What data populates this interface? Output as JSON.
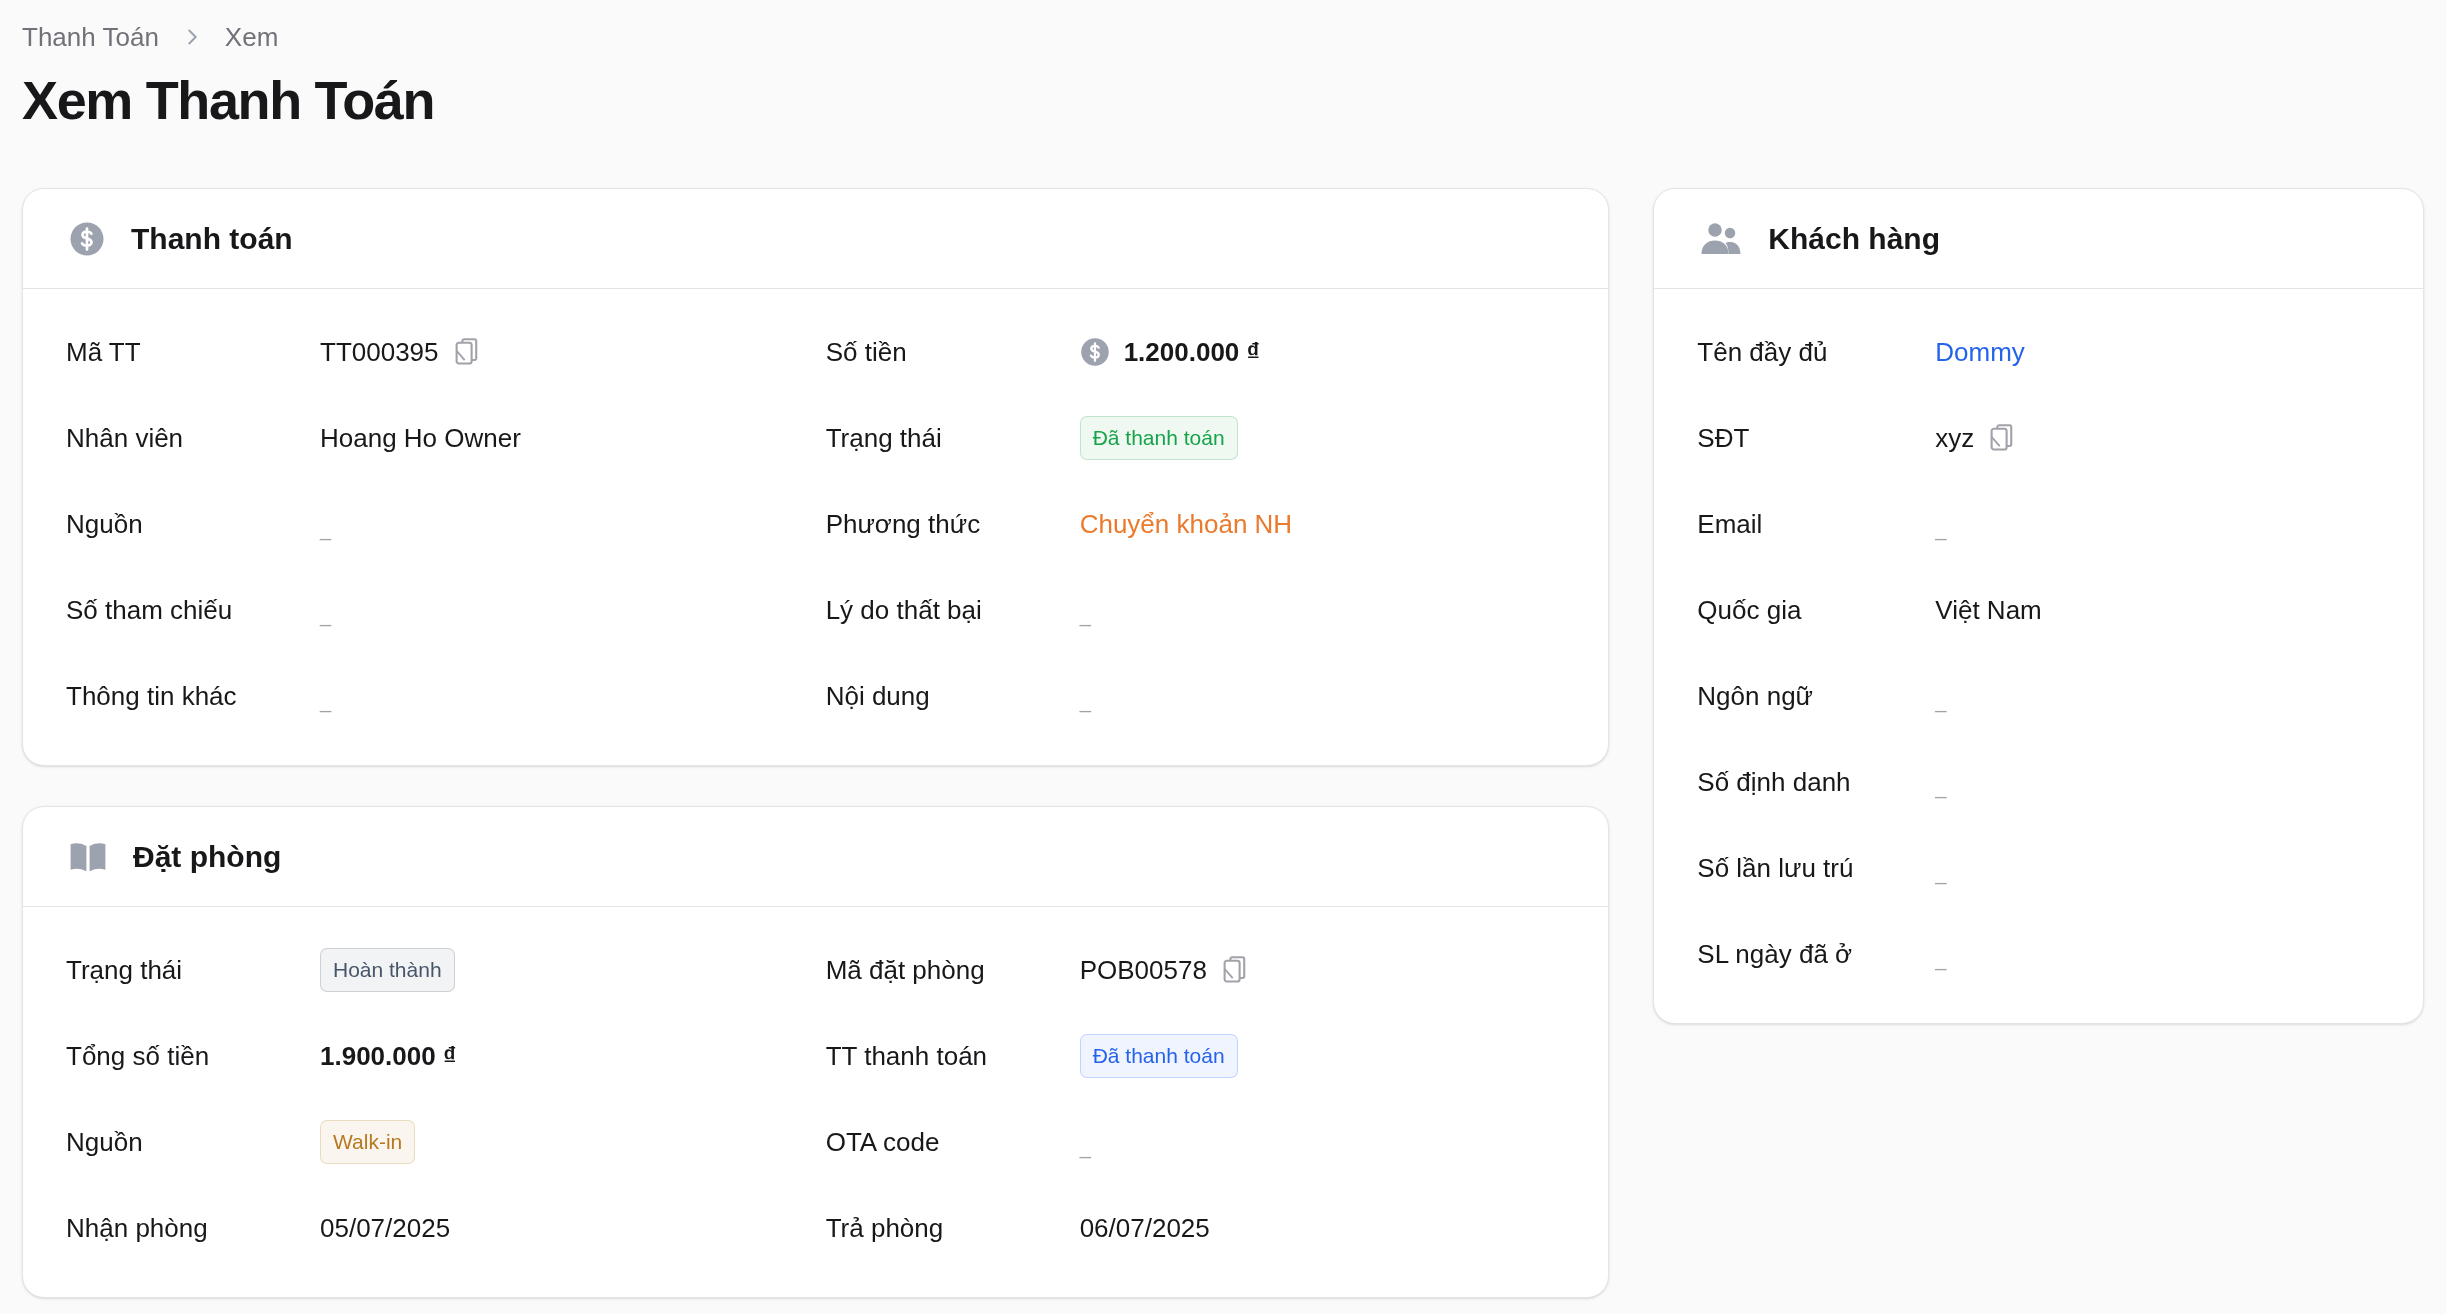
{
  "breadcrumb": [
    "Thanh Toán",
    "Xem"
  ],
  "title": "Xem Thanh Toán",
  "cards": [
    {
      "title": "Thanh toán",
      "kind": "payment",
      "items": [
        {
          "label": "Mã TT",
          "value": "TT000395",
          "kind": "copyable"
        },
        {
          "label": "Số tiền",
          "value": "1.200.000 ₫",
          "kind": "money"
        },
        {
          "label": "Nhân viên",
          "value": "Hoang Ho Owner",
          "kind": "text"
        },
        {
          "label": "Trạng thái",
          "value": "Đã thanh toán",
          "kind": "badge",
          "color": "#16a34a"
        },
        {
          "label": "Nguồn",
          "value": "_",
          "kind": "empty"
        },
        {
          "label": "Phương thức",
          "value": "Chuyển khoản NH",
          "kind": "colored",
          "color": "#ea7a2c"
        },
        {
          "label": "Số tham chiếu",
          "value": "_",
          "kind": "empty"
        },
        {
          "label": "Lý do thất bại",
          "value": "_",
          "kind": "empty"
        },
        {
          "label": "Thông tin khác",
          "value": "_",
          "kind": "empty"
        },
        {
          "label": "Nội dung",
          "value": "_",
          "kind": "empty"
        }
      ]
    },
    {
      "title": "Đặt phòng",
      "kind": "booking",
      "items": [
        {
          "label": "Trạng thái",
          "value": "Hoàn thành",
          "kind": "badge",
          "color": "#475569"
        },
        {
          "label": "Mã đặt phòng",
          "value": "POB00578",
          "kind": "copyable"
        },
        {
          "label": "Tổng số tiền",
          "value": "1.900.000 ₫",
          "kind": "bold"
        },
        {
          "label": "TT thanh toán",
          "value": "Đã thanh toán",
          "kind": "badge",
          "color": "#2563eb"
        },
        {
          "label": "Nguồn",
          "value": "Walk-in",
          "kind": "badge",
          "color": "#b7791f"
        },
        {
          "label": "OTA code",
          "value": "_",
          "kind": "empty"
        },
        {
          "label": "Nhận phòng",
          "value": "05/07/2025",
          "kind": "text"
        },
        {
          "label": "Trả phòng",
          "value": "06/07/2025",
          "kind": "text"
        }
      ]
    },
    {
      "title": "Khách hàng",
      "kind": "customer",
      "items": [
        {
          "label": "Tên đầy đủ",
          "value": "Dommy",
          "kind": "link"
        },
        {
          "label": "SĐT",
          "value": "xyz",
          "kind": "copyable"
        },
        {
          "label": "Email",
          "value": "_",
          "kind": "empty"
        },
        {
          "label": "Quốc gia",
          "value": "Việt Nam",
          "kind": "text"
        },
        {
          "label": "Ngôn ngữ",
          "value": "_",
          "kind": "empty"
        },
        {
          "label": "Số định danh",
          "value": "_",
          "kind": "empty"
        },
        {
          "label": "Số lần lưu trú",
          "value": "_",
          "kind": "empty"
        },
        {
          "label": "SL ngày đã ở",
          "value": "_",
          "kind": "empty"
        }
      ]
    }
  ]
}
